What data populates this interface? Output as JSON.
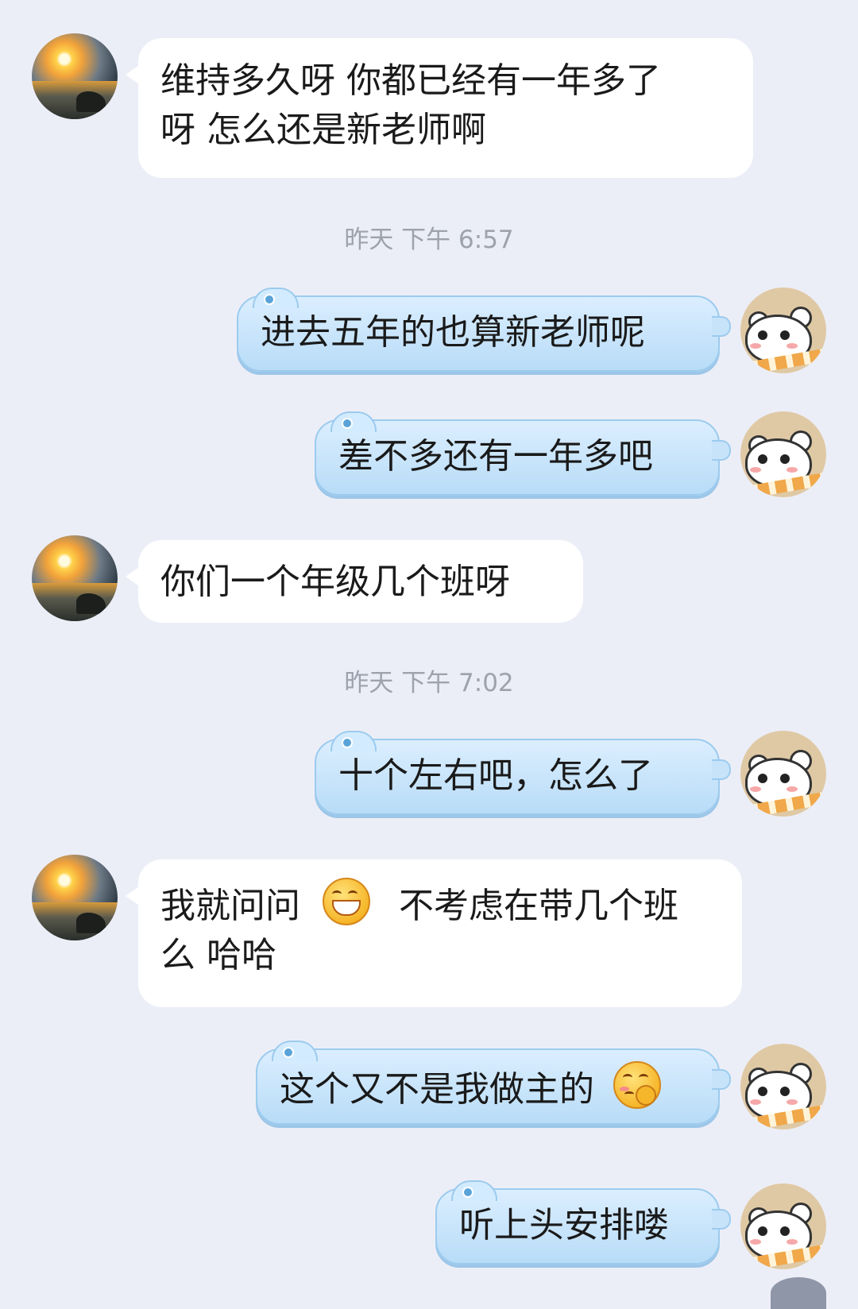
{
  "messages": [
    {
      "side": "left",
      "text": "维持多久呀 你都已经有一年多了呀 怎么还是新老师啊",
      "line1": "维持多久呀 你都已经有一年多了",
      "line2": "呀 怎么还是新老师啊"
    },
    {
      "side": "timestamp",
      "text": "昨天 下午 6:57"
    },
    {
      "side": "right",
      "text": "进去五年的也算新老师呢"
    },
    {
      "side": "right",
      "text": "差不多还有一年多吧"
    },
    {
      "side": "left",
      "text": "你们一个年级几个班呀"
    },
    {
      "side": "timestamp",
      "text": "昨天 下午 7:02"
    },
    {
      "side": "right",
      "text": "十个左右吧，怎么了"
    },
    {
      "side": "left",
      "text_before_emoji": "我就问问",
      "emoji": "grinning-emoji",
      "text_after_emoji": "不考虑在带几个班",
      "line2": "么 哈哈"
    },
    {
      "side": "right",
      "text": "这个又不是我做主的",
      "emoji": "shy-emoji"
    },
    {
      "side": "right",
      "text": "听上头安排喽"
    }
  ],
  "colors": {
    "background": "#eceef7",
    "left_bubble": "#ffffff",
    "right_bubble": "#c7e3fa",
    "timestamp": "#9ea2ad"
  }
}
